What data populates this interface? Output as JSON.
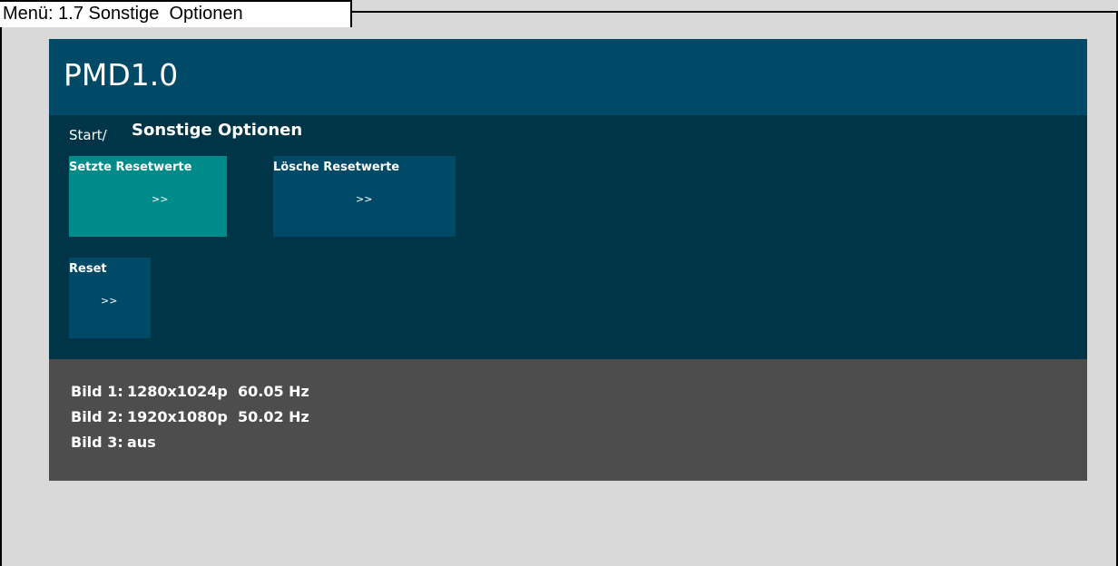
{
  "caption": "Menü: 1.7 Sonstige  Optionen",
  "app": {
    "title": "PMD1.0"
  },
  "breadcrumb": {
    "start": "Start/",
    "current": "Sonstige Optionen"
  },
  "tiles": [
    {
      "label": "Setzte Resetwerte",
      "arrow": ">>",
      "active": true
    },
    {
      "label": "Lösche Resetwerte",
      "arrow": ">>",
      "active": false
    },
    {
      "label": "Reset",
      "arrow": ">>",
      "active": false
    }
  ],
  "status": [
    {
      "key": "Bild 1:",
      "value": "1280x1024p  60.05 Hz"
    },
    {
      "key": "Bild 2:",
      "value": "1920x1080p  50.02 Hz"
    },
    {
      "key": "Bild 3:",
      "value": "aus"
    }
  ],
  "colors": {
    "header": "#004967",
    "content": "#003447",
    "tile": "#004967",
    "tile_active": "#008b8b",
    "status": "#4d4d4d",
    "outer": "#d9d9d9"
  }
}
